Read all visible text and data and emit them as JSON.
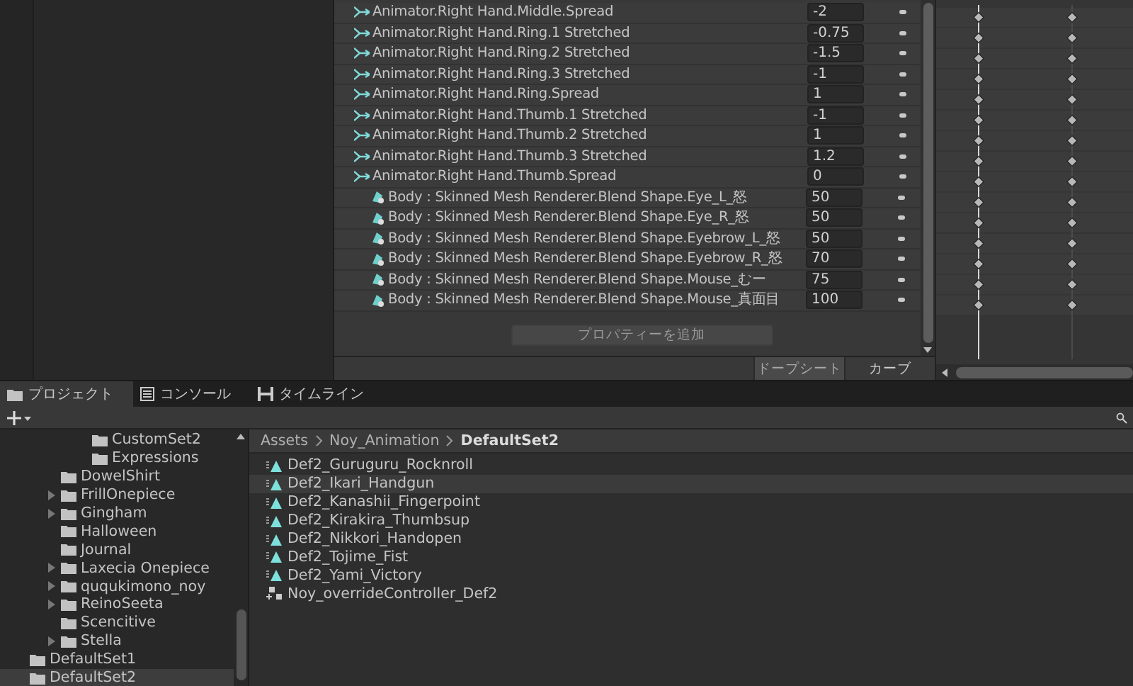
{
  "properties": [
    {
      "kind": "animator",
      "name": "Animator.Right Hand.Middle.Spread",
      "value": "-2"
    },
    {
      "kind": "animator",
      "name": "Animator.Right Hand.Ring.1 Stretched",
      "value": "-0.75"
    },
    {
      "kind": "animator",
      "name": "Animator.Right Hand.Ring.2 Stretched",
      "value": "-1.5"
    },
    {
      "kind": "animator",
      "name": "Animator.Right Hand.Ring.3 Stretched",
      "value": "-1"
    },
    {
      "kind": "animator",
      "name": "Animator.Right Hand.Ring.Spread",
      "value": "1"
    },
    {
      "kind": "animator",
      "name": "Animator.Right Hand.Thumb.1 Stretched",
      "value": "-1"
    },
    {
      "kind": "animator",
      "name": "Animator.Right Hand.Thumb.2 Stretched",
      "value": "1"
    },
    {
      "kind": "animator",
      "name": "Animator.Right Hand.Thumb.3 Stretched",
      "value": "1.2"
    },
    {
      "kind": "animator",
      "name": "Animator.Right Hand.Thumb.Spread",
      "value": "0"
    },
    {
      "kind": "blendshape",
      "name": "Body : Skinned Mesh Renderer.Blend Shape.Eye_L_怒",
      "value": "50"
    },
    {
      "kind": "blendshape",
      "name": "Body : Skinned Mesh Renderer.Blend Shape.Eye_R_怒",
      "value": "50"
    },
    {
      "kind": "blendshape",
      "name": "Body : Skinned Mesh Renderer.Blend Shape.Eyebrow_L_怒",
      "value": "50"
    },
    {
      "kind": "blendshape",
      "name": "Body : Skinned Mesh Renderer.Blend Shape.Eyebrow_R_怒",
      "value": "70"
    },
    {
      "kind": "blendshape",
      "name": "Body : Skinned Mesh Renderer.Blend Shape.Mouse_むー",
      "value": "75"
    },
    {
      "kind": "blendshape",
      "name": "Body : Skinned Mesh Renderer.Blend Shape.Mouse_真面目",
      "value": "100"
    }
  ],
  "add_property_button": "プロパティーを追加",
  "view_tabs": [
    {
      "label": "ドープシート",
      "selected": true
    },
    {
      "label": "カーブ",
      "selected": false
    }
  ],
  "panel_tabs": [
    {
      "label": "プロジェクト",
      "kind": "folder",
      "selected": true
    },
    {
      "label": "コンソール",
      "kind": "console",
      "selected": false
    },
    {
      "label": "タイムライン",
      "kind": "timeline",
      "selected": false
    }
  ],
  "tree": [
    {
      "children": [
        {
          "children": [
            {
              "label": "CustomSet2",
              "selected": false
            },
            {
              "label": "Expressions",
              "selected": false
            }
          ]
        },
        {
          "label": "DowelShirt",
          "selected": false
        },
        {
          "label": "FrillOnepiece",
          "expanded": false,
          "selected": false
        },
        {
          "label": "Gingham",
          "expanded": false,
          "selected": false
        },
        {
          "label": "Halloween",
          "selected": false
        },
        {
          "label": "Journal",
          "selected": false
        },
        {
          "label": "Laxecia Onepiece",
          "expanded": false,
          "selected": false
        },
        {
          "label": "ququkimono_noy",
          "expanded": false,
          "selected": false
        },
        {
          "label": "ReinoSeeta",
          "expanded": false,
          "selected": false
        },
        {
          "label": "Scencitive",
          "selected": false
        },
        {
          "label": "Stella",
          "expanded": false,
          "selected": false
        }
      ]
    },
    {
      "label": "DefaultSet1",
      "selected": false
    },
    {
      "label": "DefaultSet2",
      "selected": true
    }
  ],
  "breadcrumb": [
    "Assets",
    "Noy_Animation",
    "DefaultSet2"
  ],
  "assets": [
    {
      "kind": "animation",
      "label": "Def2_Guruguru_Rocknroll",
      "selected": false
    },
    {
      "kind": "animation",
      "label": "Def2_Ikari_Handgun",
      "selected": true
    },
    {
      "kind": "animation",
      "label": "Def2_Kanashii_Fingerpoint",
      "selected": false
    },
    {
      "kind": "animation",
      "label": "Def2_Kirakira_Thumbsup",
      "selected": false
    },
    {
      "kind": "animation",
      "label": "Def2_Nikkori_Handopen",
      "selected": false
    },
    {
      "kind": "animation",
      "label": "Def2_Tojime_Fist",
      "selected": false
    },
    {
      "kind": "animation",
      "label": "Def2_Yami_Victory",
      "selected": false
    },
    {
      "kind": "controller",
      "label": "Noy_overrideController_Def2",
      "selected": false
    }
  ]
}
